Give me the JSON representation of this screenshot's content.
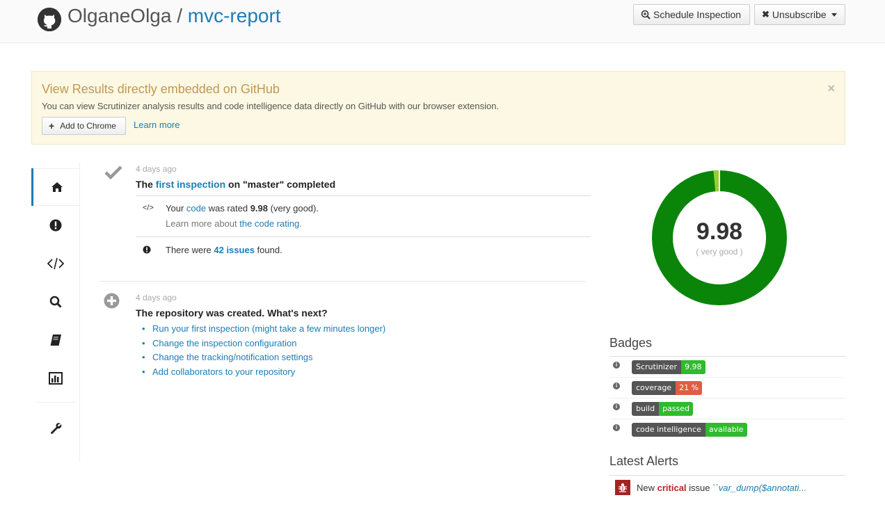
{
  "header": {
    "owner": "OlganeOlga",
    "separator": " / ",
    "repo": "mvc-report",
    "schedule_label": "Schedule Inspection",
    "unsubscribe_label": "Unsubscribe"
  },
  "banner": {
    "title": "View Results directly embedded on GitHub",
    "text": "You can view Scrutinizer analysis results and code intelligence data directly on GitHub with our browser extension.",
    "add_chrome_label": "Add to Chrome",
    "learn_more_label": "Learn more",
    "close_symbol": "×"
  },
  "sidebar": {
    "items": [
      {
        "icon": "home-icon",
        "active": true
      },
      {
        "icon": "issues-icon"
      },
      {
        "icon": "code-icon"
      },
      {
        "icon": "search-icon"
      },
      {
        "icon": "book-icon"
      },
      {
        "icon": "chart-icon"
      },
      {
        "icon": "wrench-icon"
      }
    ]
  },
  "timeline": {
    "event1": {
      "time": "4 days ago",
      "title_prefix": "The ",
      "title_link": "first inspection",
      "title_suffix": " on \"master\" completed",
      "rating": {
        "prefix": "Your ",
        "link": "code",
        "middle": " was rated ",
        "score": "9.98",
        "suffix": " (very good).",
        "learn_prefix": "Learn more about ",
        "learn_link": "the code rating",
        "learn_suffix": "."
      },
      "issues": {
        "prefix": "There were ",
        "link": "42 issues",
        "suffix": " found."
      }
    },
    "event2": {
      "time": "4 days ago",
      "title": "The repository was created. What's next?",
      "next_steps": [
        "Run your first inspection (might take a few minutes longer)",
        "Change the inspection configuration",
        "Change the tracking/notification settings",
        "Add collaborators to your repository"
      ]
    }
  },
  "score": {
    "value": "9.98",
    "label": "( very good )",
    "fraction": 0.986,
    "colors": {
      "good": "#0a850a",
      "rest": "#9acd32",
      "gap": "#ffffff"
    }
  },
  "badges": {
    "title": "Badges",
    "items": [
      {
        "label": "Scrutinizer",
        "value": "9.98",
        "color": "#2ebb2e"
      },
      {
        "label": "coverage",
        "value": "21 %",
        "color": "#e05d44"
      },
      {
        "label": "build",
        "value": "passed",
        "color": "#2ebb2e"
      },
      {
        "label": "code intelligence",
        "value": "available",
        "color": "#2ebb2e"
      }
    ],
    "info_symbol": "i"
  },
  "alerts": {
    "title": "Latest Alerts",
    "items": [
      {
        "prefix": "New ",
        "severity": "critical",
        "middle": " issue ",
        "code": "``var_dump($annotati..."
      }
    ]
  }
}
